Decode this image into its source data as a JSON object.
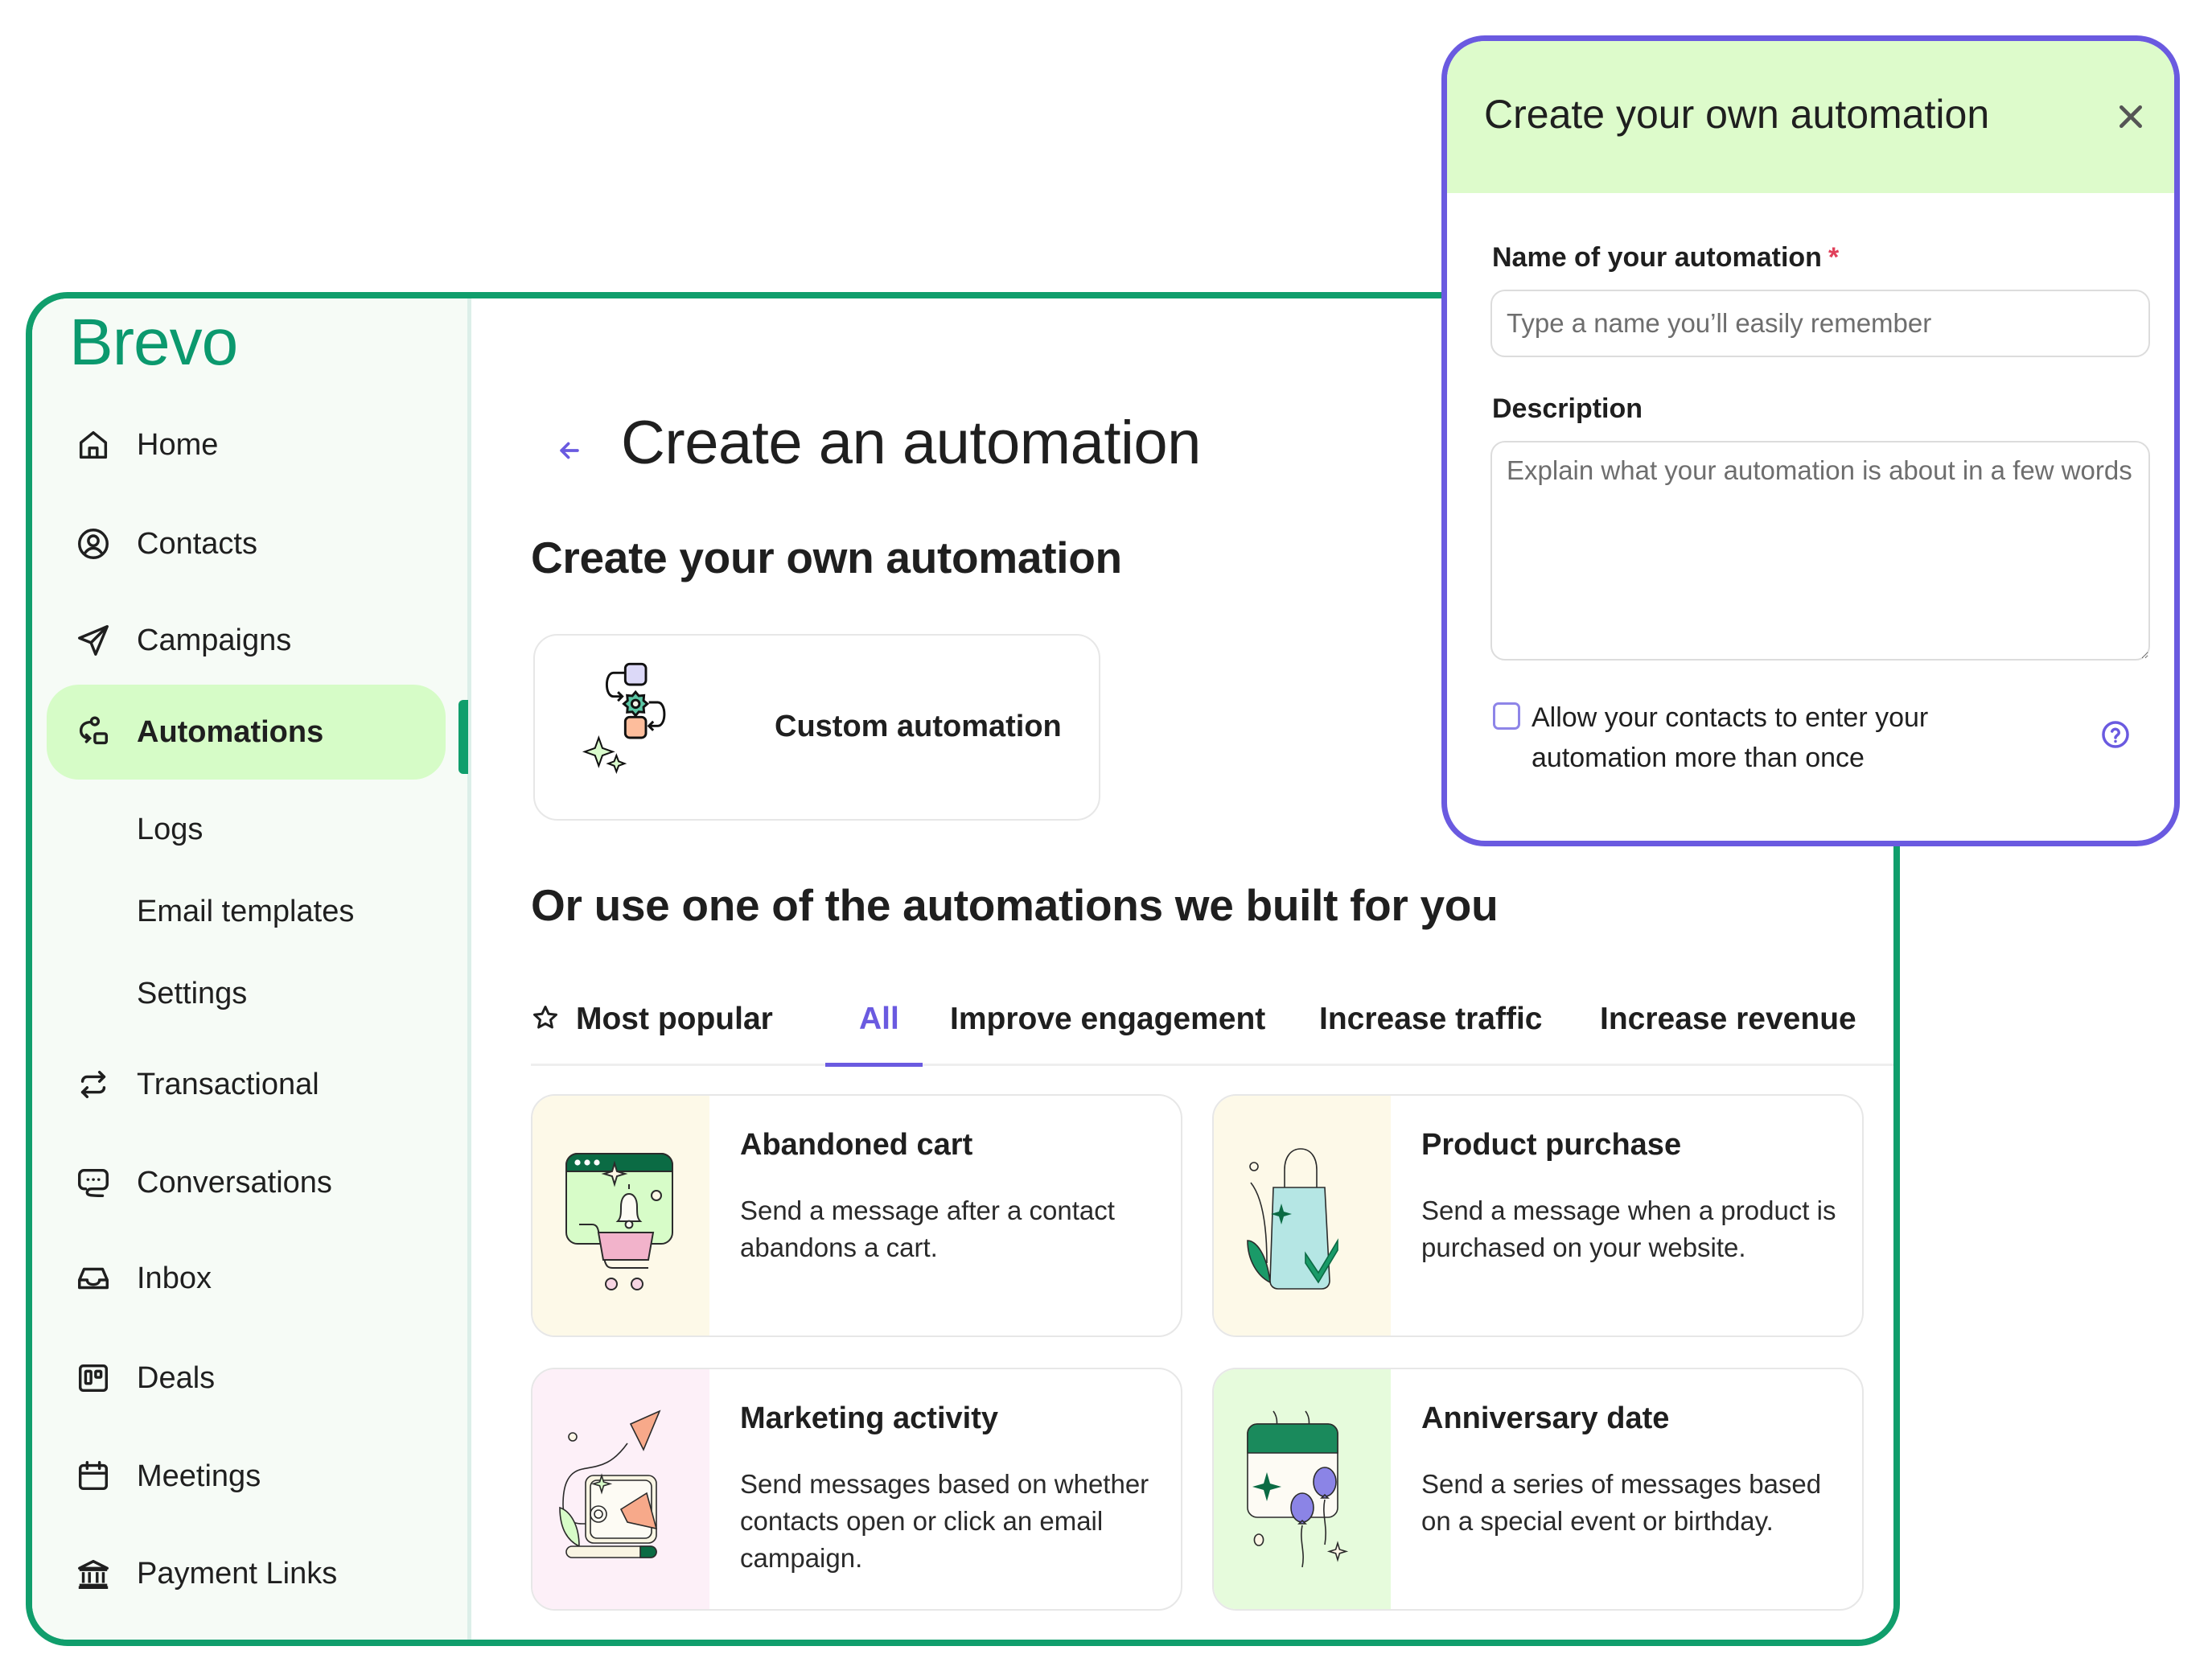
{
  "brand": {
    "name": "Brevo",
    "color": "#109e6c",
    "accent": "#6a5ae0"
  },
  "sidebar": {
    "items": [
      {
        "label": "Home",
        "icon": "home-icon"
      },
      {
        "label": "Contacts",
        "icon": "user-circle-icon"
      },
      {
        "label": "Campaigns",
        "icon": "paper-plane-icon"
      },
      {
        "label": "Automations",
        "icon": "automation-flow-icon",
        "active": true
      },
      {
        "label": "Logs",
        "sub": true
      },
      {
        "label": "Email templates",
        "sub": true
      },
      {
        "label": "Settings",
        "sub": true
      },
      {
        "label": "Transactional",
        "icon": "arrows-exchange-icon"
      },
      {
        "label": "Conversations",
        "icon": "chat-bubble-icon"
      },
      {
        "label": "Inbox",
        "icon": "inbox-tray-icon"
      },
      {
        "label": "Deals",
        "icon": "kanban-board-icon"
      },
      {
        "label": "Meetings",
        "icon": "calendar-icon"
      },
      {
        "label": "Payment Links",
        "icon": "bank-icon"
      }
    ]
  },
  "main": {
    "title": "Create an automation",
    "back_icon": "arrow-left-icon",
    "own_section_title": "Create your own automation",
    "custom_card_label": "Custom automation",
    "prebuilt_section_title": "Or use one of the automations we built for you",
    "tabs": [
      {
        "label": "Most popular",
        "icon": "star-icon"
      },
      {
        "label": "All",
        "active": true
      },
      {
        "label": "Improve engagement"
      },
      {
        "label": "Increase traffic"
      },
      {
        "label": "Increase revenue"
      }
    ],
    "templates": [
      {
        "title": "Abandoned cart",
        "description": "Send a message after a contact abandons a cart.",
        "panel_color": "#fdf9e8",
        "illustration": "shopping-cart-bell-illustration"
      },
      {
        "title": "Product purchase",
        "description": "Send a message when a product is purchased on your website.",
        "panel_color": "#fdf9e8",
        "illustration": "shopping-bag-check-illustration"
      },
      {
        "title": "Marketing activity",
        "description": "Send messages based on whether contacts open or click an email campaign.",
        "panel_color": "#fdf0f8",
        "illustration": "laptop-megaphone-illustration"
      },
      {
        "title": "Anniversary date",
        "description": "Send a series of messages based on a special event or birthday.",
        "panel_color": "#e6fbdc",
        "illustration": "calendar-balloons-illustration"
      }
    ]
  },
  "modal": {
    "title": "Create your own automation",
    "close_icon": "close-icon",
    "name_label": "Name of your automation",
    "required_mark": "*",
    "name_placeholder": "Type a name you’ll easily remember",
    "name_value": "",
    "description_label": "Description",
    "description_placeholder": "Explain what your automation is about in a few words",
    "description_value": "",
    "allow_reentry_label": "Allow your contacts to enter your automation more than once",
    "allow_reentry_checked": false,
    "help_icon": "help-circle-icon"
  }
}
